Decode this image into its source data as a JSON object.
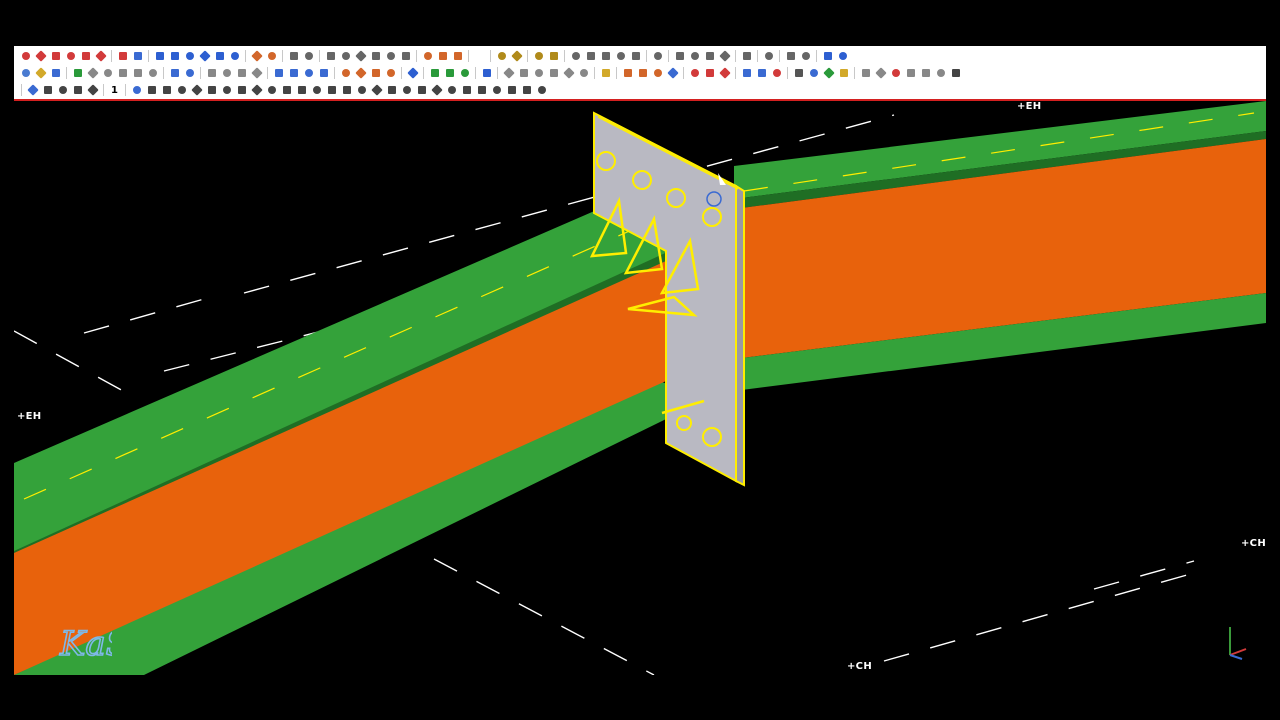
{
  "toolbars": {
    "row1": [
      {
        "icon": "line-icon",
        "color": "#d23a3a"
      },
      {
        "icon": "polyline-icon",
        "color": "#d23a3a"
      },
      {
        "icon": "check-draw-icon",
        "color": "#d23a3a"
      },
      {
        "icon": "diagonal-line-icon",
        "color": "#d23a3a"
      },
      {
        "icon": "cross-line-icon",
        "color": "#d23a3a"
      },
      {
        "icon": "arc-icon",
        "color": "#d23a3a"
      },
      {
        "sep": true
      },
      {
        "icon": "snap-icon",
        "color": "#d23a3a"
      },
      {
        "icon": "circle-icon",
        "color": "#3a6ad2"
      },
      {
        "sep": true
      },
      {
        "icon": "column-icon",
        "color": "#2d5fd1"
      },
      {
        "icon": "beam-icon",
        "color": "#2d5fd1"
      },
      {
        "icon": "brace-icon",
        "color": "#2d5fd1"
      },
      {
        "icon": "curved-beam-icon",
        "color": "#2d5fd1"
      },
      {
        "icon": "plate-icon",
        "color": "#2d5fd1"
      },
      {
        "icon": "polybeam-icon",
        "color": "#2d5fd1"
      },
      {
        "sep": true
      },
      {
        "icon": "weld-icon",
        "color": "#d2662a"
      },
      {
        "icon": "anchor-icon",
        "color": "#d2662a"
      },
      {
        "sep": true
      },
      {
        "icon": "cut-icon",
        "color": "#666666"
      },
      {
        "icon": "fit-icon",
        "color": "#666666"
      },
      {
        "sep": true
      },
      {
        "icon": "part-icon",
        "color": "#666666"
      },
      {
        "icon": "split-icon",
        "color": "#666666"
      },
      {
        "icon": "combine-icon",
        "color": "#666666"
      },
      {
        "icon": "chamfer-icon",
        "color": "#666666"
      },
      {
        "icon": "polygon-cut-icon",
        "color": "#666666"
      },
      {
        "icon": "line-cut-icon",
        "color": "#666666"
      },
      {
        "sep": true
      },
      {
        "icon": "bolt-icon",
        "color": "#d2662a"
      },
      {
        "icon": "bolt-group-icon",
        "color": "#d2662a"
      },
      {
        "icon": "hole-icon",
        "color": "#d2662a"
      },
      {
        "sep": true
      },
      {
        "icon": "blank-icon",
        "color": "#ffffff"
      },
      {
        "sep": true
      },
      {
        "icon": "rebar-icon",
        "color": "#b08a1a"
      },
      {
        "icon": "rebar-bend-icon",
        "color": "#b08a1a"
      },
      {
        "sep": true
      },
      {
        "icon": "surface-icon",
        "color": "#b08a1a"
      },
      {
        "icon": "surface-edge-icon",
        "color": "#b08a1a"
      },
      {
        "sep": true
      },
      {
        "icon": "grid-icon",
        "color": "#666666"
      },
      {
        "icon": "grid-line-icon",
        "color": "#666666"
      },
      {
        "icon": "level-icon",
        "color": "#666666"
      },
      {
        "icon": "elevation-icon",
        "color": "#666666"
      },
      {
        "icon": "section-icon",
        "color": "#666666"
      },
      {
        "sep": true
      },
      {
        "icon": "ref-model-icon",
        "color": "#666666"
      },
      {
        "sep": true
      },
      {
        "icon": "mark-icon",
        "color": "#666666"
      },
      {
        "icon": "dimension-icon",
        "color": "#666666"
      },
      {
        "icon": "text-icon",
        "color": "#666666"
      },
      {
        "icon": "symbol-icon",
        "color": "#666666"
      },
      {
        "sep": true
      },
      {
        "icon": "measure-icon",
        "color": "#666666"
      },
      {
        "sep": true
      },
      {
        "icon": "component-icon",
        "color": "#666666"
      },
      {
        "sep": true
      },
      {
        "icon": "move-icon",
        "color": "#666666"
      },
      {
        "icon": "gear-icon",
        "color": "#666666"
      },
      {
        "sep": true
      },
      {
        "icon": "undo-view-icon",
        "color": "#2d5fd1"
      },
      {
        "icon": "redo-view-icon",
        "color": "#2d5fd1"
      }
    ],
    "row2": [
      {
        "icon": "new-icon",
        "color": "#4a7bd1"
      },
      {
        "icon": "open-icon",
        "color": "#d2a92a"
      },
      {
        "icon": "save-icon",
        "color": "#3a6ad2"
      },
      {
        "sep": true
      },
      {
        "icon": "share-icon",
        "color": "#2a9a3a"
      },
      {
        "icon": "cube-icon",
        "color": "#888888"
      },
      {
        "icon": "cube-shaded-icon",
        "color": "#888888"
      },
      {
        "icon": "cube-wire-icon",
        "color": "#888888"
      },
      {
        "icon": "cube-hidden-icon",
        "color": "#888888"
      },
      {
        "icon": "cube-render-icon",
        "color": "#888888"
      },
      {
        "sep": true
      },
      {
        "icon": "undo-icon",
        "color": "#3a6ad2"
      },
      {
        "icon": "redo-icon",
        "color": "#3a6ad2"
      },
      {
        "sep": true
      },
      {
        "icon": "copy-icon",
        "color": "#888888"
      },
      {
        "icon": "paste-icon",
        "color": "#888888"
      },
      {
        "icon": "clipboard-icon",
        "color": "#888888"
      },
      {
        "icon": "rotate-icon",
        "color": "#888888"
      },
      {
        "sep": true
      },
      {
        "icon": "select-all-icon",
        "color": "#3a6ad2"
      },
      {
        "icon": "select-part-icon",
        "color": "#3a6ad2"
      },
      {
        "icon": "select-assembly-icon",
        "color": "#3a6ad2"
      },
      {
        "icon": "select-component-icon",
        "color": "#3a6ad2"
      },
      {
        "sep": true
      },
      {
        "icon": "filter-icon",
        "color": "#d2662a"
      },
      {
        "icon": "filter-list-icon",
        "color": "#d2662a"
      },
      {
        "icon": "filter-view-icon",
        "color": "#d2662a"
      },
      {
        "icon": "filter-select-icon",
        "color": "#d2662a"
      },
      {
        "sep": true
      },
      {
        "icon": "zoom-icon",
        "color": "#2d5fd1"
      },
      {
        "sep": true
      },
      {
        "icon": "numbering-icon",
        "color": "#2a9a3a"
      },
      {
        "icon": "numbering-all-icon",
        "color": "#2a9a3a"
      },
      {
        "icon": "clash-icon",
        "color": "#2a9a3a"
      },
      {
        "sep": true
      },
      {
        "icon": "drawing-icon",
        "color": "#2d5fd1"
      },
      {
        "sep": true
      },
      {
        "icon": "snap-end-icon",
        "color": "#888888"
      },
      {
        "icon": "snap-mid-icon",
        "color": "#888888"
      },
      {
        "icon": "snap-near-icon",
        "color": "#888888"
      },
      {
        "icon": "snap-intersect-icon",
        "color": "#888888"
      },
      {
        "icon": "snap-perp-icon",
        "color": "#888888"
      },
      {
        "icon": "snap-line-icon",
        "color": "#888888"
      },
      {
        "sep": true
      },
      {
        "icon": "pick-icon",
        "color": "#d2a92a"
      },
      {
        "sep": true
      },
      {
        "icon": "report-icon",
        "color": "#d2662a"
      },
      {
        "icon": "template-icon",
        "color": "#d2662a"
      },
      {
        "icon": "list-icon",
        "color": "#d2662a"
      },
      {
        "icon": "catalog-icon",
        "color": "#3a6ad2"
      },
      {
        "sep": true
      },
      {
        "icon": "organizer-icon",
        "color": "#d23a3a"
      },
      {
        "icon": "phase-icon",
        "color": "#d23a3a"
      },
      {
        "icon": "lot-icon",
        "color": "#d23a3a"
      },
      {
        "sep": true
      },
      {
        "icon": "arrow-right-icon",
        "color": "#3a6ad2"
      },
      {
        "icon": "view-list-icon",
        "color": "#3a6ad2"
      },
      {
        "icon": "view-props-icon",
        "color": "#d23a3a"
      },
      {
        "sep": true
      },
      {
        "icon": "lock-icon",
        "color": "#555555"
      },
      {
        "icon": "tree-icon",
        "color": "#3a6ad2"
      },
      {
        "icon": "tree-expand-icon",
        "color": "#2a9a3a"
      },
      {
        "icon": "tag-icon",
        "color": "#d2a92a"
      },
      {
        "sep": true
      },
      {
        "icon": "pin-icon",
        "color": "#888888"
      },
      {
        "icon": "tools-icon",
        "color": "#888888"
      },
      {
        "icon": "stop-icon",
        "color": "#d23a3a"
      },
      {
        "icon": "layers-icon",
        "color": "#888888"
      },
      {
        "icon": "window-icon",
        "color": "#888888"
      },
      {
        "icon": "stack-icon",
        "color": "#888888"
      },
      {
        "icon": "close-box-icon",
        "color": "#444444"
      }
    ],
    "row3": [
      {
        "sep": true
      },
      {
        "icon": "align-icon",
        "color": "#3a6ad2"
      },
      {
        "icon": "distribute-icon",
        "color": "#444444"
      },
      {
        "icon": "home-icon",
        "color": "#444444"
      },
      {
        "icon": "arrow-left-icon",
        "color": "#444444"
      },
      {
        "icon": "arrow-right-icon",
        "color": "#444444"
      },
      {
        "sep": true
      },
      {
        "num": "1"
      },
      {
        "sep": true
      },
      {
        "icon": "view-plan-icon",
        "color": "#3a6ad2"
      },
      {
        "icon": "view-front-icon",
        "color": "#444444"
      },
      {
        "icon": "view-back-icon",
        "color": "#444444"
      },
      {
        "icon": "view-left-icon",
        "color": "#444444"
      },
      {
        "icon": "view-right-icon",
        "color": "#444444"
      },
      {
        "icon": "view-top-icon",
        "color": "#444444"
      },
      {
        "icon": "view-bottom-icon",
        "color": "#444444"
      },
      {
        "icon": "view-iso-icon",
        "color": "#444444"
      },
      {
        "icon": "view-grid-1-icon",
        "color": "#444444"
      },
      {
        "icon": "view-grid-2-icon",
        "color": "#444444"
      },
      {
        "icon": "view-grid-3-icon",
        "color": "#444444"
      },
      {
        "icon": "view-grid-4-icon",
        "color": "#444444"
      },
      {
        "icon": "view-grid-5-icon",
        "color": "#444444"
      },
      {
        "icon": "view-grid-6-icon",
        "color": "#444444"
      },
      {
        "icon": "view-grid-7-icon",
        "color": "#444444"
      },
      {
        "icon": "view-grid-8-icon",
        "color": "#444444"
      },
      {
        "icon": "view-grid-9-icon",
        "color": "#444444"
      },
      {
        "icon": "view-grid-10-icon",
        "color": "#444444"
      },
      {
        "icon": "view-grid-11-icon",
        "color": "#444444"
      },
      {
        "icon": "view-grid-12-icon",
        "color": "#444444"
      },
      {
        "icon": "view-grid-13-icon",
        "color": "#444444"
      },
      {
        "icon": "view-grid-14-icon",
        "color": "#444444"
      },
      {
        "icon": "view-grid-15-icon",
        "color": "#444444"
      },
      {
        "icon": "view-grid-16-icon",
        "color": "#444444"
      },
      {
        "icon": "view-grid-17-icon",
        "color": "#444444"
      },
      {
        "icon": "view-grid-18-icon",
        "color": "#444444"
      },
      {
        "icon": "view-grid-19-icon",
        "color": "#444444"
      },
      {
        "icon": "view-grid-20-icon",
        "color": "#444444"
      }
    ]
  },
  "grid_labels": {
    "eh_top": "+EH",
    "eh_left": "+EH",
    "ch_right": "+CH",
    "ch_bottom": "+CH"
  },
  "model": {
    "flange_color": "#34a23a",
    "web_color": "#e8620c",
    "plate_color": "#b9b9c2",
    "highlight_color": "#ffee00",
    "background_color": "#000000"
  },
  "logo": {
    "text": "KaS"
  }
}
